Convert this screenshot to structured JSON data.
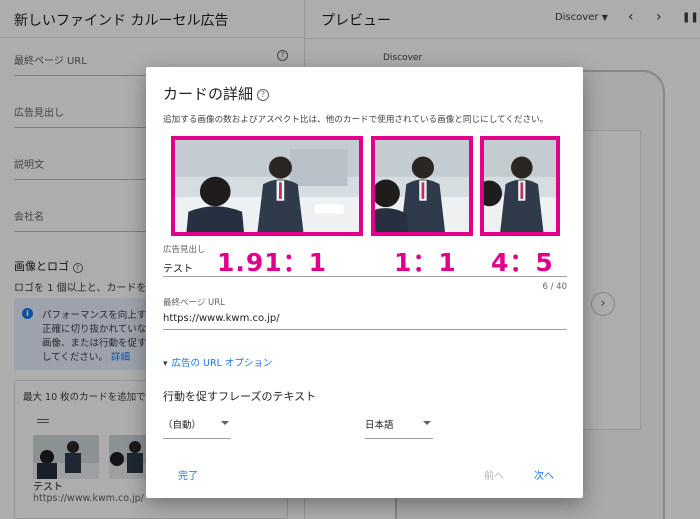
{
  "left": {
    "header": "新しいファインド カルーセル広告",
    "fields": [
      "最終ページ URL",
      "広告見出し",
      "説明文",
      "会社名"
    ],
    "section_title": "画像とロゴ",
    "section_sub": "ロゴを 1 個以上と、カードを 2 枚",
    "info_lines": [
      "パフォーマンスを向上す",
      "正確に切り抜かれていない",
      "画像、または行動を促すフ",
      "してください。"
    ],
    "info_link": "詳細",
    "max_cards": "最大 10 枚のカードを追加でき",
    "card_title": "テスト",
    "card_url": "https://www.kwm.co.jp/"
  },
  "right": {
    "title": "プレビュー",
    "dropdown": "Discover",
    "discover_label": "Discover",
    "prev_icon": "‹",
    "next_icon": "›",
    "pause_icon": "❚❚"
  },
  "modal": {
    "title": "カードの詳細",
    "description": "追加する画像の数およびアスペクト比は、他のカードで使用されている画像と同じにしてください。",
    "ratios": [
      "1.91：1",
      "1：1",
      "4：5"
    ],
    "headline_label": "広告見出し",
    "headline_value": "テスト",
    "counter": "6 / 40",
    "url_label": "最終ページ URL",
    "url_value": "https://www.kwm.co.jp/",
    "url_options": "広告の URL オプション",
    "cta_title": "行動を促すフレーズのテキスト",
    "cta_select": "（自動）",
    "lang_select": "日本語",
    "done": "完了",
    "prev": "前へ",
    "next": "次へ"
  },
  "colors": {
    "accent": "#1a73e8",
    "highlight": "#e0008c"
  }
}
